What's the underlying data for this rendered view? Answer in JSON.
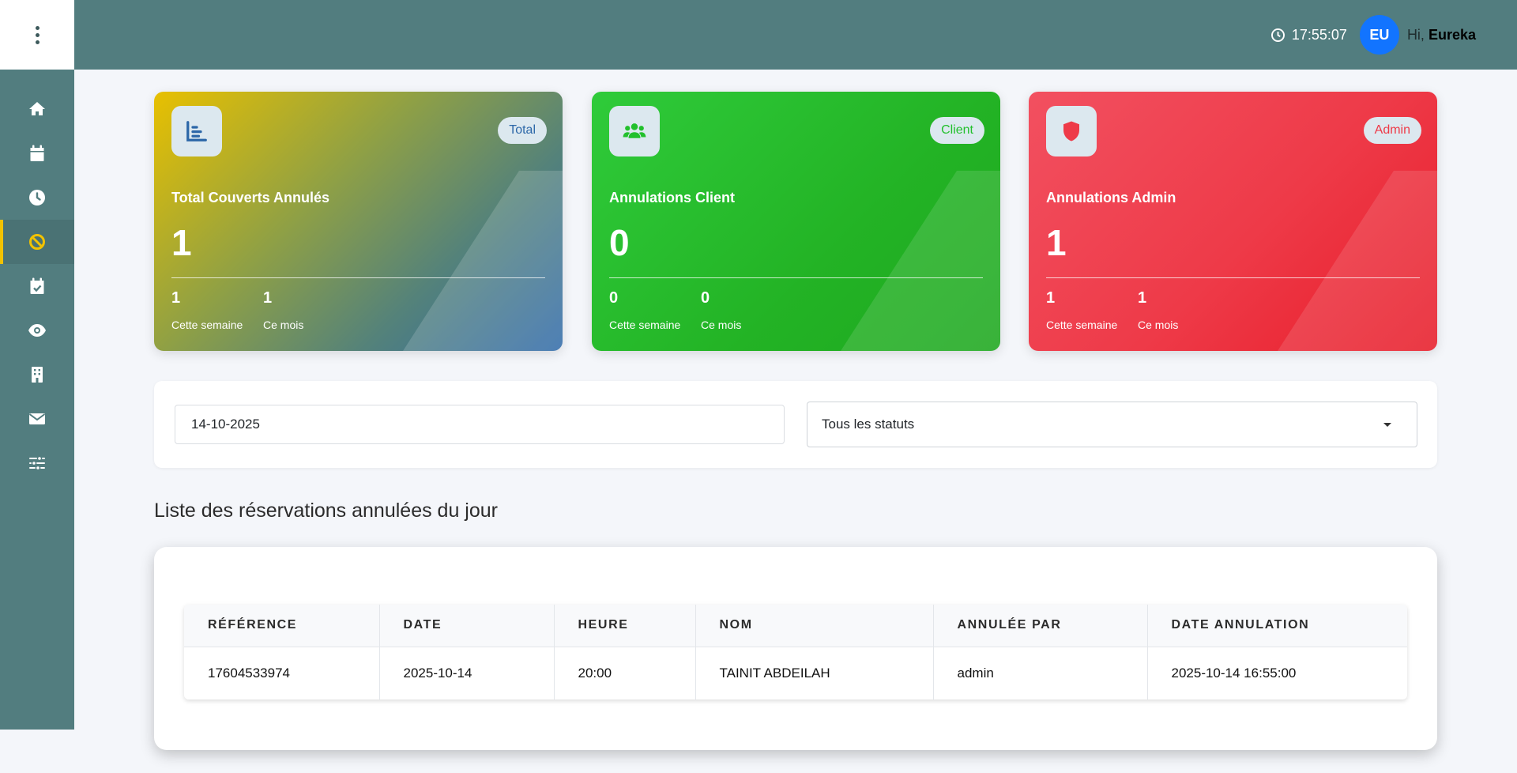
{
  "header": {
    "time": "17:55:07",
    "avatar_initials": "EU",
    "greeting": "Hi,",
    "user_name": "Eureka"
  },
  "sidebar": {
    "items": [
      {
        "icon": "home-icon"
      },
      {
        "icon": "calendar-icon"
      },
      {
        "icon": "clock-icon"
      },
      {
        "icon": "ban-icon",
        "active": true
      },
      {
        "icon": "calendar-check-icon"
      },
      {
        "icon": "eye-icon"
      },
      {
        "icon": "building-icon"
      },
      {
        "icon": "envelope-icon"
      },
      {
        "icon": "sliders-icon"
      }
    ],
    "active_indicator_color": "#f2c200"
  },
  "cards": [
    {
      "badge": "Total",
      "title": "Total Couverts Annulés",
      "value": "1",
      "week_value": "1",
      "week_label": "Cette semaine",
      "month_value": "1",
      "month_label": "Ce mois",
      "accent": "#2c67a8"
    },
    {
      "badge": "Client",
      "title": "Annulations Client",
      "value": "0",
      "week_value": "0",
      "week_label": "Cette semaine",
      "month_value": "0",
      "month_label": "Ce mois",
      "accent": "#22c02c"
    },
    {
      "badge": "Admin",
      "title": "Annulations Admin",
      "value": "1",
      "week_value": "1",
      "week_label": "Cette semaine",
      "month_value": "1",
      "month_label": "Ce mois",
      "accent": "#ee3a48"
    }
  ],
  "filters": {
    "date_value": "14-10-2025",
    "status_selected": "Tous les statuts"
  },
  "section_title": "Liste des réservations annulées du jour",
  "table": {
    "columns": [
      "RÉFÉRENCE",
      "DATE",
      "HEURE",
      "NOM",
      "ANNULÉE PAR",
      "DATE ANNULATION"
    ],
    "rows": [
      [
        "17604533974",
        "2025-10-14",
        "20:00",
        "TAINIT ABDEILAH",
        "admin",
        "2025-10-14 16:55:00"
      ]
    ]
  }
}
